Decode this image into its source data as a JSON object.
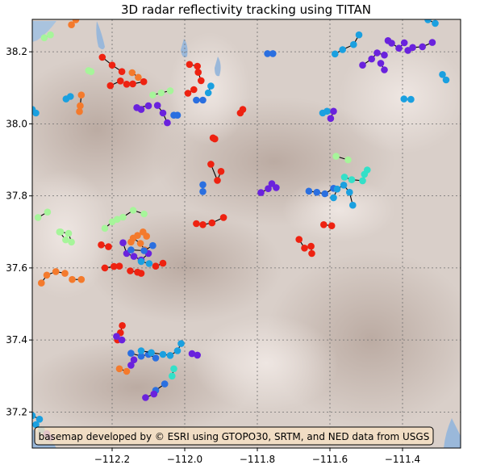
{
  "chart_data": {
    "type": "scatter",
    "title": "3D radar reflectivity tracking using TITAN",
    "xlabel": "",
    "ylabel": "",
    "xlim": [
      -112.42,
      -111.24
    ],
    "ylim": [
      37.1,
      38.29
    ],
    "x_ticks": [
      {
        "value": -112.2,
        "label": "−112.2"
      },
      {
        "value": -112.0,
        "label": "−112.0"
      },
      {
        "value": -111.8,
        "label": "−111.8"
      },
      {
        "value": -111.6,
        "label": "−111.6"
      },
      {
        "value": -111.4,
        "label": "−111.4"
      }
    ],
    "y_ticks": [
      {
        "value": 37.2,
        "label": "37.2"
      },
      {
        "value": 37.4,
        "label": "37.4"
      },
      {
        "value": 37.6,
        "label": "37.6"
      },
      {
        "value": 37.8,
        "label": "37.8"
      },
      {
        "value": 38.0,
        "label": "38.0"
      },
      {
        "value": 38.2,
        "label": "38.2"
      }
    ],
    "grid": true,
    "grid_style": "dotted",
    "basemap_credit": "basemap developed by © ESRI using GTOPO30, SRTM, and NED data from USGS",
    "colors": {
      "red": "#ee2211",
      "orange": "#f47a2c",
      "purple": "#6a22dd",
      "blue": "#2a6fe0",
      "skyblue": "#1aa0e0",
      "cyan": "#33e0c8",
      "lightgreen": "#a6f59a",
      "track_line": "#000000",
      "terrain": "#d9cfc9",
      "water": "#9ab8da"
    },
    "tracks": [
      {
        "color": "red",
        "points": [
          [
            -112.173,
            38.145
          ],
          [
            -112.2,
            38.163
          ],
          [
            -112.227,
            38.185
          ]
        ]
      },
      {
        "color": "red",
        "points": [
          [
            -112.177,
            38.119
          ],
          [
            -112.205,
            38.106
          ]
        ]
      },
      {
        "color": "red",
        "points": [
          [
            -112.113,
            38.117
          ],
          [
            -112.143,
            38.111
          ],
          [
            -112.16,
            38.11
          ]
        ]
      },
      {
        "color": "orange",
        "points": [
          [
            -112.128,
            38.129
          ],
          [
            -112.145,
            38.142
          ]
        ]
      },
      {
        "color": "red",
        "points": [
          [
            -111.991,
            38.085
          ],
          [
            -111.975,
            38.095
          ]
        ]
      },
      {
        "color": "red",
        "points": [
          [
            -111.987,
            38.165
          ],
          [
            -111.965,
            38.16
          ]
        ]
      },
      {
        "color": "red",
        "points": [
          [
            -111.963,
            38.143
          ],
          [
            -111.955,
            38.12
          ]
        ]
      },
      {
        "color": "orange",
        "points": [
          [
            -112.285,
            38.08
          ],
          [
            -112.288,
            38.05
          ],
          [
            -112.29,
            38.034
          ]
        ]
      },
      {
        "color": "purple",
        "points": [
          [
            -112.1,
            38.05
          ],
          [
            -112.132,
            38.045
          ],
          [
            -112.12,
            38.04
          ]
        ]
      },
      {
        "color": "purple",
        "points": [
          [
            -112.075,
            38.051
          ],
          [
            -112.06,
            38.03
          ],
          [
            -112.048,
            38.003
          ]
        ]
      },
      {
        "color": "blue",
        "points": [
          [
            -112.03,
            38.024
          ],
          [
            -112.02,
            38.024
          ]
        ]
      },
      {
        "color": "skyblue",
        "points": [
          [
            -112.327,
            38.069
          ],
          [
            -112.315,
            38.076
          ]
        ]
      },
      {
        "color": "lightgreen",
        "points": [
          [
            -112.088,
            38.08
          ],
          [
            -112.065,
            38.086
          ],
          [
            -112.04,
            38.092
          ]
        ]
      },
      {
        "color": "blue",
        "points": [
          [
            -111.968,
            38.066
          ],
          [
            -111.95,
            38.066
          ]
        ]
      },
      {
        "color": "skyblue",
        "points": [
          [
            -111.935,
            38.086
          ],
          [
            -111.928,
            38.105
          ]
        ]
      },
      {
        "color": "blue",
        "points": [
          [
            -111.772,
            38.195
          ],
          [
            -111.757,
            38.195
          ]
        ]
      },
      {
        "color": "skyblue",
        "points": [
          [
            -111.586,
            38.194
          ],
          [
            -111.565,
            38.206
          ],
          [
            -111.535,
            38.22
          ],
          [
            -111.52,
            38.247
          ]
        ]
      },
      {
        "color": "purple",
        "points": [
          [
            -111.51,
            38.163
          ],
          [
            -111.485,
            38.18
          ],
          [
            -111.47,
            38.197
          ],
          [
            -111.45,
            38.191
          ]
        ]
      },
      {
        "color": "purple",
        "points": [
          [
            -111.44,
            38.231
          ],
          [
            -111.43,
            38.224
          ],
          [
            -111.41,
            38.21
          ],
          [
            -111.395,
            38.225
          ]
        ]
      },
      {
        "color": "purple",
        "points": [
          [
            -111.385,
            38.204
          ],
          [
            -111.372,
            38.212
          ],
          [
            -111.345,
            38.214
          ],
          [
            -111.318,
            38.226
          ]
        ]
      },
      {
        "color": "purple",
        "points": [
          [
            -111.45,
            38.15
          ],
          [
            -111.46,
            38.168
          ]
        ]
      },
      {
        "color": "skyblue",
        "points": [
          [
            -111.29,
            38.137
          ],
          [
            -111.28,
            38.122
          ]
        ]
      },
      {
        "color": "skyblue",
        "points": [
          [
            -111.396,
            38.069
          ],
          [
            -111.377,
            38.068
          ]
        ]
      },
      {
        "color": "skyblue",
        "points": [
          [
            -111.62,
            38.03
          ],
          [
            -111.608,
            38.035
          ]
        ]
      },
      {
        "color": "purple",
        "points": [
          [
            -111.59,
            38.035
          ],
          [
            -111.598,
            38.015
          ]
        ]
      },
      {
        "color": "skyblue",
        "points": [
          [
            -111.31,
            38.279
          ],
          [
            -111.33,
            38.289
          ]
        ]
      },
      {
        "color": "lightgreen",
        "points": [
          [
            -112.37,
            38.247
          ],
          [
            -112.387,
            38.239
          ]
        ]
      },
      {
        "color": "skyblue",
        "points": [
          [
            -112.42,
            38.04
          ],
          [
            -112.41,
            38.03
          ]
        ]
      },
      {
        "color": "red",
        "points": [
          [
            -111.847,
            38.03
          ],
          [
            -111.84,
            38.04
          ]
        ]
      },
      {
        "color": "red",
        "points": [
          [
            -111.922,
            37.961
          ],
          [
            -111.917,
            37.958
          ]
        ]
      },
      {
        "color": "red",
        "points": [
          [
            -111.928,
            37.888
          ],
          [
            -111.91,
            37.843
          ],
          [
            -111.9,
            37.868
          ]
        ]
      },
      {
        "color": "blue",
        "points": [
          [
            -111.95,
            37.812
          ],
          [
            -111.95,
            37.831
          ]
        ]
      },
      {
        "color": "purple",
        "points": [
          [
            -111.79,
            37.809
          ],
          [
            -111.77,
            37.82
          ],
          [
            -111.76,
            37.834
          ],
          [
            -111.748,
            37.823
          ]
        ]
      },
      {
        "color": "blue",
        "points": [
          [
            -111.658,
            37.813
          ],
          [
            -111.636,
            37.81
          ],
          [
            -111.614,
            37.806
          ],
          [
            -111.59,
            37.821
          ]
        ]
      },
      {
        "color": "skyblue",
        "points": [
          [
            -111.59,
            37.795
          ],
          [
            -111.58,
            37.819
          ],
          [
            -111.562,
            37.83
          ],
          [
            -111.546,
            37.81
          ],
          [
            -111.537,
            37.774
          ]
        ]
      },
      {
        "color": "cyan",
        "points": [
          [
            -111.56,
            37.852
          ],
          [
            -111.54,
            37.845
          ],
          [
            -111.51,
            37.842
          ],
          [
            -111.497,
            37.872
          ],
          [
            -111.505,
            37.86
          ]
        ]
      },
      {
        "color": "lightgreen",
        "points": [
          [
            -111.583,
            37.91
          ],
          [
            -111.55,
            37.9
          ]
        ]
      },
      {
        "color": "red",
        "points": [
          [
            -111.617,
            37.72
          ],
          [
            -111.595,
            37.717
          ]
        ]
      },
      {
        "color": "red",
        "points": [
          [
            -111.685,
            37.679
          ],
          [
            -111.67,
            37.655
          ],
          [
            -111.652,
            37.66
          ],
          [
            -111.65,
            37.64
          ]
        ]
      },
      {
        "color": "red",
        "points": [
          [
            -111.968,
            37.723
          ],
          [
            -111.95,
            37.72
          ],
          [
            -111.925,
            37.725
          ],
          [
            -111.893,
            37.74
          ]
        ]
      },
      {
        "color": "lightgreen",
        "points": [
          [
            -112.404,
            37.74
          ],
          [
            -112.378,
            37.755
          ]
        ]
      },
      {
        "color": "lightgreen",
        "points": [
          [
            -112.342,
            37.7
          ],
          [
            -112.32,
            37.696
          ],
          [
            -112.312,
            37.672
          ],
          [
            -112.328,
            37.678
          ],
          [
            -112.345,
            37.7
          ]
        ]
      },
      {
        "color": "lightgreen",
        "points": [
          [
            -112.22,
            37.71
          ],
          [
            -112.2,
            37.728
          ],
          [
            -112.186,
            37.735
          ],
          [
            -112.17,
            37.741
          ],
          [
            -112.142,
            37.76
          ],
          [
            -112.112,
            37.75
          ]
        ]
      },
      {
        "color": "orange",
        "points": [
          [
            -112.148,
            37.672
          ],
          [
            -112.13,
            37.69
          ],
          [
            -112.115,
            37.7
          ],
          [
            -112.105,
            37.688
          ]
        ]
      },
      {
        "color": "orange",
        "points": [
          [
            -112.142,
            37.683
          ],
          [
            -112.122,
            37.668
          ],
          [
            -112.11,
            37.65
          ]
        ]
      },
      {
        "color": "purple",
        "points": [
          [
            -112.17,
            37.67
          ],
          [
            -112.16,
            37.64
          ],
          [
            -112.14,
            37.632
          ],
          [
            -112.12,
            37.622
          ],
          [
            -112.1,
            37.64
          ]
        ]
      },
      {
        "color": "blue",
        "points": [
          [
            -112.148,
            37.65
          ],
          [
            -112.112,
            37.648
          ],
          [
            -112.088,
            37.662
          ]
        ]
      },
      {
        "color": "skyblue",
        "points": [
          [
            -112.12,
            37.618
          ],
          [
            -112.098,
            37.612
          ]
        ]
      },
      {
        "color": "red",
        "points": [
          [
            -112.22,
            37.6
          ],
          [
            -112.195,
            37.604
          ],
          [
            -112.18,
            37.605
          ]
        ]
      },
      {
        "color": "red",
        "points": [
          [
            -112.23,
            37.664
          ],
          [
            -112.21,
            37.659
          ]
        ]
      },
      {
        "color": "red",
        "points": [
          [
            -112.15,
            37.592
          ],
          [
            -112.13,
            37.588
          ],
          [
            -112.12,
            37.585
          ]
        ]
      },
      {
        "color": "red",
        "points": [
          [
            -112.08,
            37.605
          ],
          [
            -112.06,
            37.613
          ]
        ]
      },
      {
        "color": "orange",
        "points": [
          [
            -112.395,
            37.558
          ],
          [
            -112.38,
            37.58
          ],
          [
            -112.355,
            37.59
          ],
          [
            -112.33,
            37.585
          ]
        ]
      },
      {
        "color": "orange",
        "points": [
          [
            -112.31,
            37.568
          ],
          [
            -112.285,
            37.568
          ]
        ]
      },
      {
        "color": "red",
        "points": [
          [
            -112.172,
            37.44
          ],
          [
            -112.177,
            37.42
          ],
          [
            -112.185,
            37.4
          ]
        ]
      },
      {
        "color": "purple",
        "points": [
          [
            -112.188,
            37.41
          ],
          [
            -112.173,
            37.4
          ]
        ]
      },
      {
        "color": "orange",
        "points": [
          [
            -112.18,
            37.32
          ],
          [
            -112.16,
            37.313
          ]
        ]
      },
      {
        "color": "blue",
        "points": [
          [
            -112.148,
            37.363
          ],
          [
            -112.12,
            37.355
          ],
          [
            -112.1,
            37.36
          ],
          [
            -112.08,
            37.35
          ]
        ]
      },
      {
        "color": "skyblue",
        "points": [
          [
            -112.12,
            37.37
          ],
          [
            -112.092,
            37.365
          ],
          [
            -112.06,
            37.36
          ],
          [
            -112.04,
            37.357
          ],
          [
            -112.02,
            37.37
          ],
          [
            -112.01,
            37.39
          ]
        ]
      },
      {
        "color": "cyan",
        "points": [
          [
            -112.03,
            37.32
          ],
          [
            -112.035,
            37.3
          ]
        ]
      },
      {
        "color": "purple",
        "points": [
          [
            -112.148,
            37.33
          ],
          [
            -112.14,
            37.345
          ]
        ]
      },
      {
        "color": "purple",
        "points": [
          [
            -111.98,
            37.362
          ],
          [
            -111.965,
            37.358
          ]
        ]
      },
      {
        "color": "blue",
        "points": [
          [
            -112.055,
            37.278
          ],
          [
            -112.08,
            37.26
          ]
        ]
      },
      {
        "color": "purple",
        "points": [
          [
            -112.108,
            37.24
          ],
          [
            -112.085,
            37.25
          ]
        ]
      },
      {
        "color": "skyblue",
        "points": [
          [
            -112.41,
            37.165
          ],
          [
            -112.395,
            37.15
          ]
        ]
      },
      {
        "color": "purple",
        "points": [
          [
            -112.38,
            37.14
          ],
          [
            -112.37,
            37.128
          ]
        ]
      },
      {
        "color": "skyblue",
        "points": [
          [
            -112.4,
            37.18
          ],
          [
            -112.42,
            37.19
          ]
        ]
      },
      {
        "color": "lightgreen",
        "points": [
          [
            -112.258,
            38.145
          ],
          [
            -112.265,
            38.148
          ]
        ]
      },
      {
        "color": "orange",
        "points": [
          [
            -112.3,
            38.289
          ],
          [
            -112.312,
            38.275
          ]
        ]
      }
    ]
  }
}
